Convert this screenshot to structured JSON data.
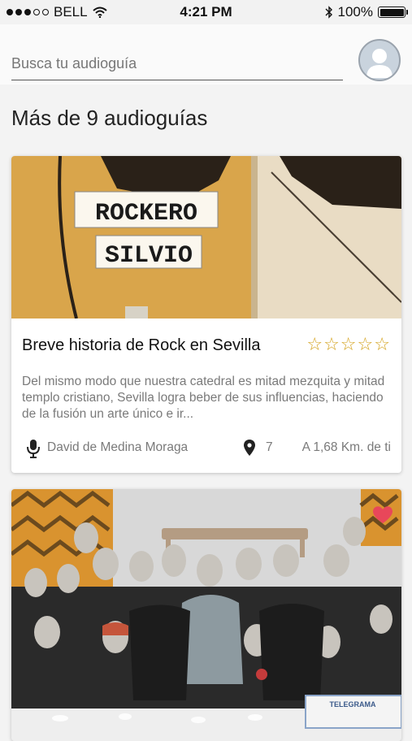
{
  "status_bar": {
    "carrier": "BELL",
    "time": "4:21 PM",
    "battery": "100%"
  },
  "search": {
    "placeholder": "Busca tu audioguía",
    "value": ""
  },
  "section_title": "Más de 9 audioguías",
  "cards": [
    {
      "title": "Breve historia de Rock en Sevilla",
      "sign_line1": "ROCKERO",
      "sign_line2": "SILVIO",
      "rating_stars": 0,
      "rating_max": 5,
      "description": "Del mismo modo que nuestra catedral es mitad mezquita y mitad templo cristiano, Sevilla logra beber de sus influencias, haciendo de la fusión un arte único e ir...",
      "author": "David de Medina Moraga",
      "stops": "7",
      "distance": "A 1,68 Km. de ti",
      "favorite": false
    },
    {
      "label": "TELEGRAMA",
      "favorite": true
    }
  ],
  "colors": {
    "star": "#d4a21c",
    "favorite": "#e8475a",
    "text_secondary": "#7a7a7a"
  }
}
